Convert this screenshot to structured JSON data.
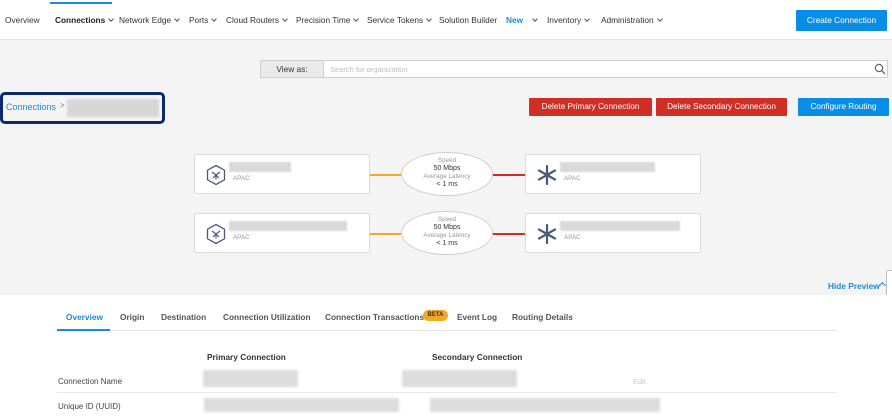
{
  "nav": {
    "items": [
      {
        "label": "Overview"
      },
      {
        "label": "Connections"
      },
      {
        "label": "Network Edge"
      },
      {
        "label": "Ports"
      },
      {
        "label": "Cloud Routers"
      },
      {
        "label": "Precision Time"
      },
      {
        "label": "Service Tokens"
      },
      {
        "label": "Solution Builder"
      },
      {
        "label": "New"
      },
      {
        "label": "Inventory"
      },
      {
        "label": "Administration"
      }
    ],
    "create_button": "Create Connection"
  },
  "view_as": {
    "label": "View as:",
    "placeholder": "Search for organization"
  },
  "breadcrumb": {
    "root": "Connections",
    "separator": ">"
  },
  "actions": {
    "delete_primary": "Delete Primary Connection",
    "delete_secondary": "Delete Secondary Connection",
    "configure_routing": "Configure Routing"
  },
  "diagram": {
    "primary": {
      "a_region": "APAC",
      "z_region": "APAC",
      "speed_label": "Speed",
      "speed_value": "50 Mbps",
      "latency_label": "Average Latency",
      "latency_value": "< 1 ms"
    },
    "secondary": {
      "a_region": "APAC",
      "z_region": "APAC",
      "speed_label": "Speed",
      "speed_value": "50 Mbps",
      "latency_label": "Average Latency",
      "latency_value": "< 1 ms"
    },
    "colors": {
      "a_side_line": "#f5a623",
      "z_side_line": "#cf2e24",
      "icon": "#4a5a7a"
    }
  },
  "hide_preview": "Hide Preview",
  "tabs": [
    {
      "label": "Overview"
    },
    {
      "label": "Origin"
    },
    {
      "label": "Destination"
    },
    {
      "label": "Connection Utilization"
    },
    {
      "label": "Connection Transactions"
    },
    {
      "label": "Event Log"
    },
    {
      "label": "Routing Details"
    }
  ],
  "beta_badge": "BETA",
  "details": {
    "primary_header": "Primary Connection",
    "secondary_header": "Secondary Connection",
    "rows": [
      {
        "label": "Connection Name"
      },
      {
        "label": "Unique ID (UUID)"
      }
    ],
    "edit_label": "Edit"
  }
}
